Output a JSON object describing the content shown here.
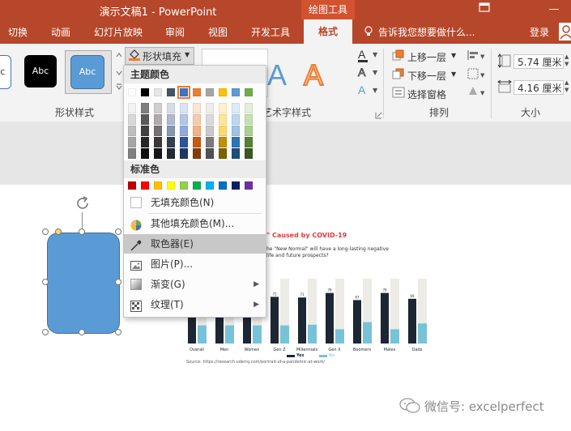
{
  "titlebar": {
    "title": "演示文稿1  -  PowerPoint",
    "context_tab": "绘图工具",
    "restore_icon": "window-restore-icon",
    "minimize_symbol": "—"
  },
  "tabs": {
    "items": [
      "切换",
      "动画",
      "幻灯片放映",
      "审阅",
      "视图",
      "开发工具",
      "格式"
    ],
    "active": "格式",
    "tell_me": "告诉我您想要做什么...",
    "login": "登录"
  },
  "ribbon": {
    "shape_styles": {
      "label": "形状样式",
      "presets": [
        "Abc",
        "Abc",
        "Abc"
      ],
      "fill_button": "形状填充"
    },
    "wordart": {
      "label": "艺术字样式",
      "letter": "A"
    },
    "arrange": {
      "label": "排列",
      "bring_forward": "上移一层",
      "send_backward": "下移一层",
      "selection_pane": "选择窗格"
    },
    "size": {
      "label": "大小",
      "height": "5.74 厘米",
      "width": "4.16 厘米"
    }
  },
  "dropdown": {
    "theme_colors_header": "主题颜色",
    "standard_colors_header": "标准色",
    "theme_top_row": [
      "#ffffff",
      "#000000",
      "#e7e6e6",
      "#44546a",
      "#4472c4",
      "#ed7d31",
      "#a5a5a5",
      "#ffc000",
      "#5b9bd5",
      "#70ad47"
    ],
    "theme_columns": [
      [
        "#f2f2f2",
        "#d9d9d9",
        "#bfbfbf",
        "#a6a6a6",
        "#808080"
      ],
      [
        "#7f7f7f",
        "#595959",
        "#404040",
        "#262626",
        "#0d0d0d"
      ],
      [
        "#d0cece",
        "#aeabab",
        "#757171",
        "#3a3838",
        "#171616"
      ],
      [
        "#d6dce5",
        "#adb9ca",
        "#8497b0",
        "#333f50",
        "#222a35"
      ],
      [
        "#dae3f3",
        "#b4c7e7",
        "#8faadc",
        "#2f5597",
        "#203864"
      ],
      [
        "#fbe5d6",
        "#f8cbad",
        "#f4b183",
        "#c55a11",
        "#843c0c"
      ],
      [
        "#ededed",
        "#dbdbdb",
        "#c9c9c9",
        "#7b7b7b",
        "#525252"
      ],
      [
        "#fff2cc",
        "#ffe699",
        "#ffd966",
        "#bf9000",
        "#7f6000"
      ],
      [
        "#deebf7",
        "#bdd7ee",
        "#9dc3e6",
        "#2e75b6",
        "#1f4e79"
      ],
      [
        "#e2f0d9",
        "#c5e0b4",
        "#a9d18e",
        "#548235",
        "#385723"
      ]
    ],
    "standard_colors": [
      "#c00000",
      "#ff0000",
      "#ffc000",
      "#ffff00",
      "#92d050",
      "#00b050",
      "#00b0f0",
      "#0070c0",
      "#002060",
      "#7030a0"
    ],
    "menu": [
      {
        "label": "无填充颜色(N)",
        "icon": "no-fill-icon",
        "submenu": false
      },
      {
        "label": "其他填充颜色(M)...",
        "icon": "color-palette-icon",
        "submenu": false
      },
      {
        "label": "取色器(E)",
        "icon": "eyedropper-icon",
        "submenu": false,
        "highlighted": true
      },
      {
        "label": "图片(P)...",
        "icon": "picture-icon",
        "submenu": false
      },
      {
        "label": "渐变(G)",
        "icon": "gradient-icon",
        "submenu": true
      },
      {
        "label": "纹理(T)",
        "icon": "texture-icon",
        "submenu": true
      }
    ]
  },
  "slide": {
    "shape_color": "#5b9bd5",
    "chart_title": "\" Caused by COVID-19",
    "chart_subtitle_1": "he \"New Normal\" will have a long-lasting negative",
    "chart_subtitle_2": "life and future prospects?",
    "bar_labels": [
      "Overall",
      "Men",
      "Women",
      "Gen Z",
      "Millennials",
      "Gen X",
      "Boomers",
      "Males",
      "Dads"
    ],
    "bar_top_values": [
      "",
      "",
      "",
      "72",
      "71",
      "78",
      "67",
      "78",
      "69"
    ],
    "legend": [
      "Yes",
      "No"
    ],
    "source": "Source: https://research.udemy.com/portrait-of-a-pandemic-at-work/",
    "watermark": "微信号: excelperfect"
  },
  "chart_data": {
    "type": "bar",
    "categories": [
      "Overall",
      "Men",
      "Women",
      "Gen Z",
      "Millennials",
      "Gen X",
      "Boomers",
      "Males",
      "Dads"
    ],
    "series": [
      {
        "name": "Yes",
        "values": [
          72,
          72,
          72,
          72,
          71,
          78,
          67,
          78,
          69
        ]
      },
      {
        "name": "No",
        "values": [
          28,
          28,
          28,
          28,
          29,
          22,
          33,
          22,
          31
        ]
      }
    ],
    "ylim": [
      0,
      100
    ]
  }
}
